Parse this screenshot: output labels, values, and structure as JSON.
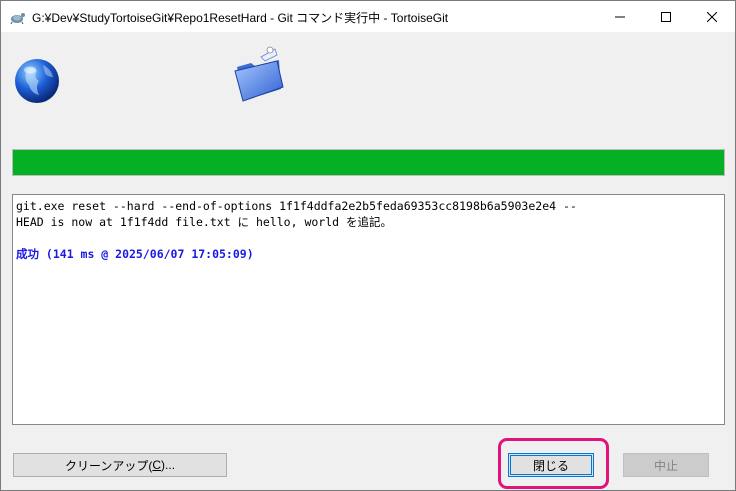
{
  "window": {
    "title": "G:¥Dev¥StudyTortoiseGit¥Repo1ResetHard - Git コマンド実行中 - TortoiseGit"
  },
  "progress": {
    "fraction": 1.0,
    "color": "#06b025"
  },
  "log": {
    "lines": [
      "git.exe reset --hard --end-of-options 1f1f4ddfa2e2b5feda69353cc8198b6a5903e2e4 --",
      "HEAD is now at 1f1f4dd file.txt に hello, world を追記。"
    ],
    "result": "成功 (141 ms @ 2025/06/07 17:05:09)"
  },
  "buttons": {
    "cleanup_label": "クリーンアップ(",
    "cleanup_mnemonic": "C",
    "cleanup_suffix": ")...",
    "close_label": "閉じる",
    "abort_label": "中止"
  },
  "colors": {
    "highlight": "#e0137d",
    "success_text": "#1a1ae6"
  }
}
